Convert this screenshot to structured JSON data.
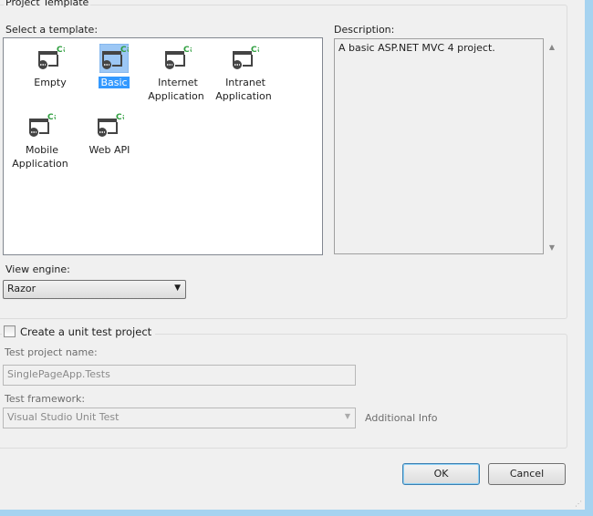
{
  "project_template": {
    "legend": "Project Template",
    "select_label": "Select a template:",
    "templates": [
      {
        "name": "Empty"
      },
      {
        "name": "Basic",
        "selected": true
      },
      {
        "name": "Internet Application"
      },
      {
        "name": "Intranet Application"
      },
      {
        "name": "Mobile Application"
      },
      {
        "name": "Web API"
      }
    ],
    "description_label": "Description:",
    "description": "A basic ASP.NET MVC 4 project.",
    "view_engine_label": "View engine:",
    "view_engine": "Razor"
  },
  "unit_test": {
    "checkbox_label": "Create a unit test project",
    "checked": false,
    "name_label": "Test project name:",
    "name_value": "SinglePageApp.Tests",
    "framework_label": "Test framework:",
    "framework_value": "Visual Studio Unit Test",
    "additional_info": "Additional Info"
  },
  "buttons": {
    "ok": "OK",
    "cancel": "Cancel"
  },
  "colors": {
    "selection": "#3399ff",
    "csharp_badge": "#2e9e3e",
    "frame": "#a6d3f0"
  }
}
